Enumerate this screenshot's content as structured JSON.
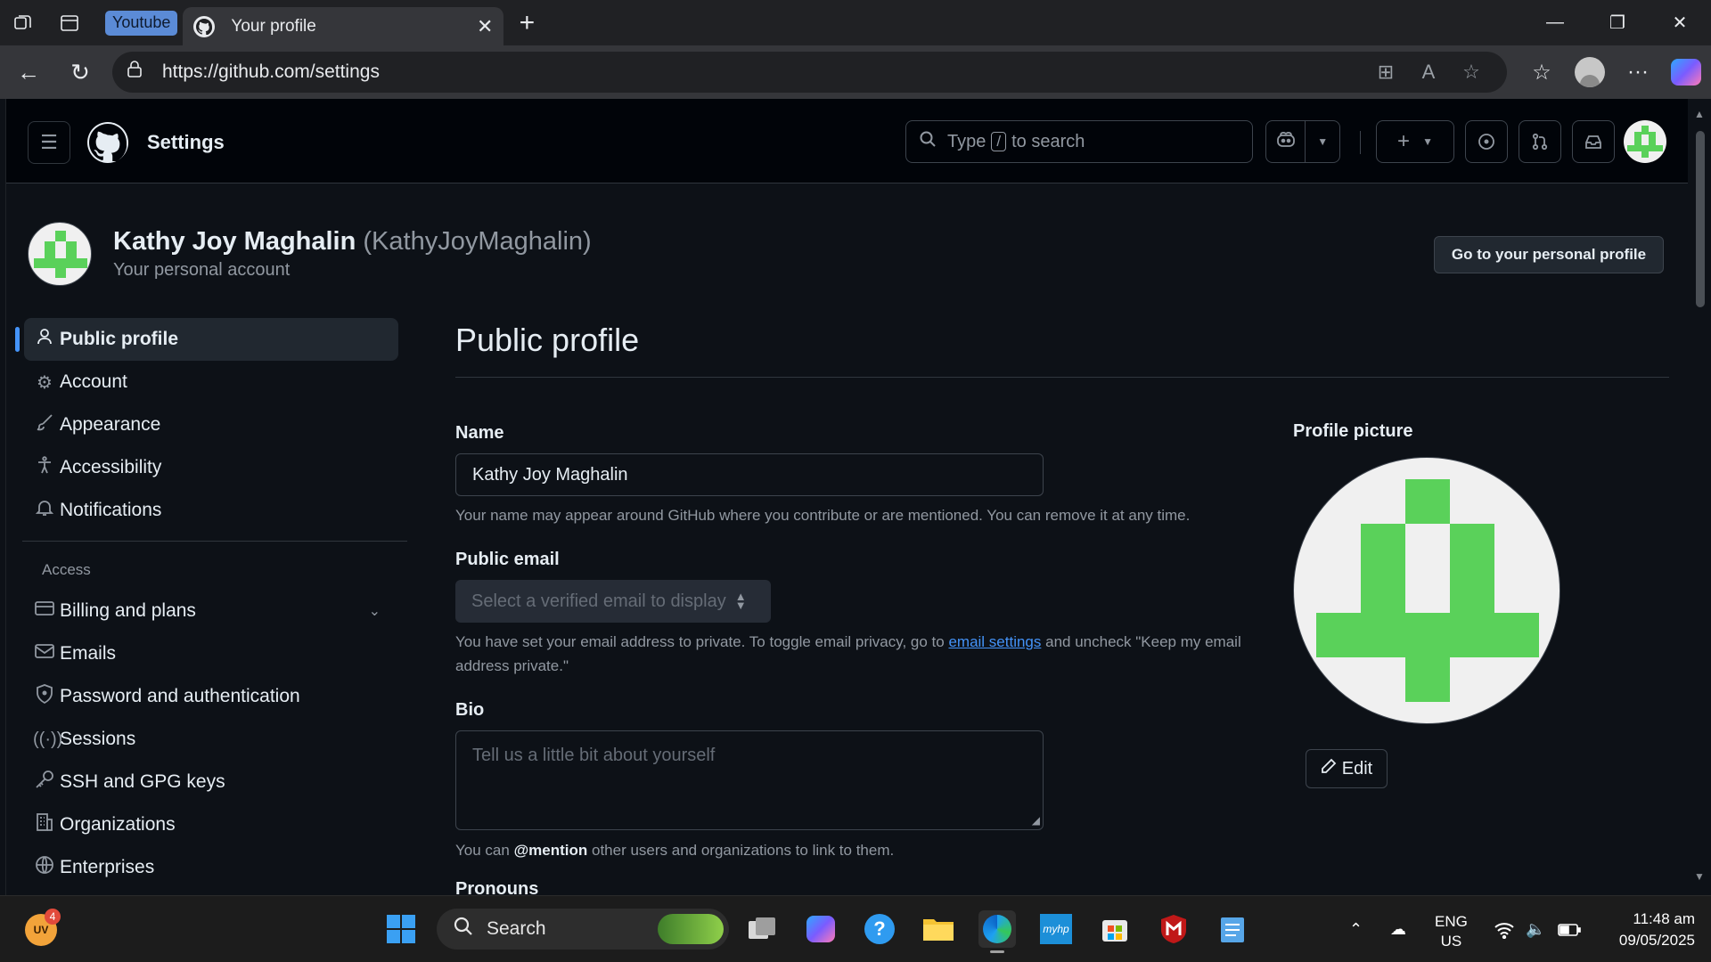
{
  "browser": {
    "workspace_label": "Youtube",
    "tab_title": "Your profile",
    "url": "https://github.com/settings"
  },
  "header": {
    "title": "Settings",
    "search_prefix": "Type",
    "search_key": "/",
    "search_suffix": "to search"
  },
  "account": {
    "name": "Kathy Joy Maghalin",
    "handle": "(KathyJoyMaghalin)",
    "subtitle": "Your personal account",
    "profile_button": "Go to your personal profile"
  },
  "sidebar": {
    "items": [
      {
        "label": "Public profile",
        "icon": "person-icon"
      },
      {
        "label": "Account",
        "icon": "gear-icon"
      },
      {
        "label": "Appearance",
        "icon": "paintbrush-icon"
      },
      {
        "label": "Accessibility",
        "icon": "accessibility-icon"
      },
      {
        "label": "Notifications",
        "icon": "bell-icon"
      }
    ],
    "access_heading": "Access",
    "access_items": [
      {
        "label": "Billing and plans",
        "icon": "credit-card-icon"
      },
      {
        "label": "Emails",
        "icon": "mail-icon"
      },
      {
        "label": "Password and authentication",
        "icon": "shield-icon"
      },
      {
        "label": "Sessions",
        "icon": "broadcast-icon"
      },
      {
        "label": "SSH and GPG keys",
        "icon": "key-icon"
      },
      {
        "label": "Organizations",
        "icon": "organization-icon"
      },
      {
        "label": "Enterprises",
        "icon": "globe-icon"
      }
    ]
  },
  "main": {
    "title": "Public profile",
    "name_label": "Name",
    "name_value": "Kathy Joy Maghalin",
    "name_hint": "Your name may appear around GitHub where you contribute or are mentioned. You can remove it at any time.",
    "email_label": "Public email",
    "email_placeholder": "Select a verified email to display",
    "email_hint_before": "You have set your email address to private. To toggle email privacy, go to",
    "email_hint_link": "email settings",
    "email_hint_after": "and uncheck \"Keep my email address private.\"",
    "bio_label": "Bio",
    "bio_placeholder": "Tell us a little bit about yourself",
    "bio_hint_before": "You can",
    "bio_hint_mention": "@mention",
    "bio_hint_after": "other users and organizations to link to them.",
    "pronouns_label": "Pronouns",
    "picture_label": "Profile picture",
    "edit_label": "Edit"
  },
  "taskbar": {
    "user_initials": "UV",
    "user_badge": "4",
    "search_label": "Search",
    "lang_line1": "ENG",
    "lang_line2": "US",
    "time": "11:48 am",
    "date": "09/05/2025"
  },
  "colors": {
    "accent": "#4493f8",
    "identicon": "#5ad15a",
    "page_bg": "#0d1117"
  }
}
